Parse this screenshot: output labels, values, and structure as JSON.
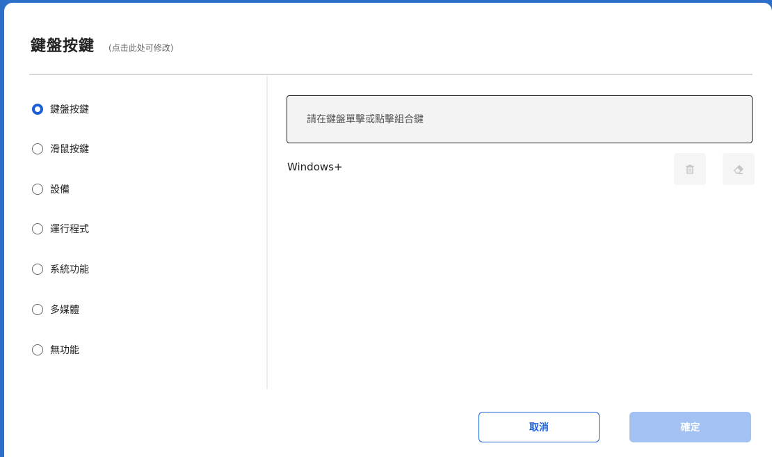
{
  "dialog": {
    "title": "鍵盤按鍵",
    "subtitle": "(点击此处可修改)"
  },
  "options": [
    {
      "label": "鍵盤按鍵",
      "checked": true
    },
    {
      "label": "滑鼠按鍵",
      "checked": false
    },
    {
      "label": "設備",
      "checked": false
    },
    {
      "label": "運行程式",
      "checked": false
    },
    {
      "label": "系統功能",
      "checked": false
    },
    {
      "label": "多媒體",
      "checked": false
    },
    {
      "label": "無功能",
      "checked": false
    }
  ],
  "key_input": {
    "placeholder": "請在鍵盤單擊或點擊組合鍵",
    "value": ""
  },
  "combo": {
    "text": "Windows+"
  },
  "icons": {
    "delete": "trash-icon",
    "clear": "eraser-icon"
  },
  "buttons": {
    "cancel": "取消",
    "ok": "確定"
  },
  "colors": {
    "accent": "#1a5fd6",
    "ok_disabled": "#a3c1f2",
    "frame": "#2b6fc8"
  }
}
